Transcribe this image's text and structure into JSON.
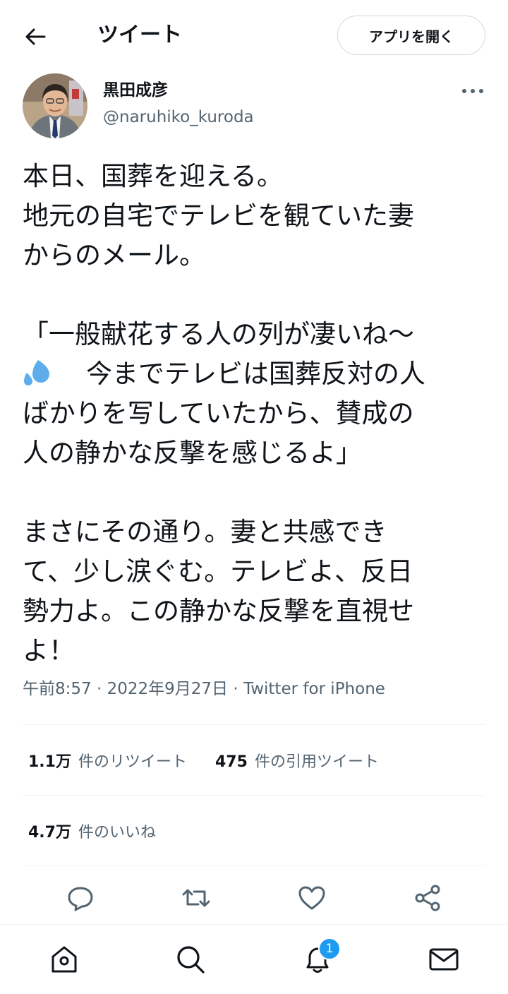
{
  "header": {
    "title": "ツイート",
    "open_app_label": "アプリを開く"
  },
  "author": {
    "display_name": "黒田成彦",
    "handle": "@naruhiko_kuroda"
  },
  "tweet": {
    "lines": [
      "本日、国葬を迎える。",
      "地元の自宅でテレビを観ていた妻",
      "からのメール。",
      "",
      "「一般献花する人の列が凄いね〜",
      "今までテレビは国葬反対の人",
      "ばかりを写していたから、賛成の",
      "人の静かな反撃を感じるよ」",
      "",
      "まさにその通り。妻と共感でき",
      "て、少し涙ぐむ。テレビよ、反日",
      "勢力よ。この静かな反撃を直視せ",
      "よ！"
    ],
    "time": "午前8:57",
    "date": "2022年9月27日",
    "client": "Twitter for iPhone",
    "separator": "·"
  },
  "stats": {
    "retweets_count": "1.1万",
    "retweets_label": "件のリツイート",
    "quotes_count": "475",
    "quotes_label": "件の引用ツイート",
    "likes_count": "4.7万",
    "likes_label": "件のいいね"
  },
  "notifications": {
    "badge_count": "1"
  },
  "icons": {
    "back": "back-arrow-icon",
    "more": "more-icon",
    "emoji": "sweat-droplets-icon",
    "reply": "reply-icon",
    "retweet": "retweet-icon",
    "like": "heart-icon",
    "share": "share-icon",
    "home": "home-icon",
    "search": "search-icon",
    "notifications": "bell-icon",
    "messages": "mail-icon"
  },
  "colors": {
    "accent": "#1d9bf0",
    "text": "#0f1419",
    "muted": "#536471",
    "emoji": "#5dadec"
  }
}
